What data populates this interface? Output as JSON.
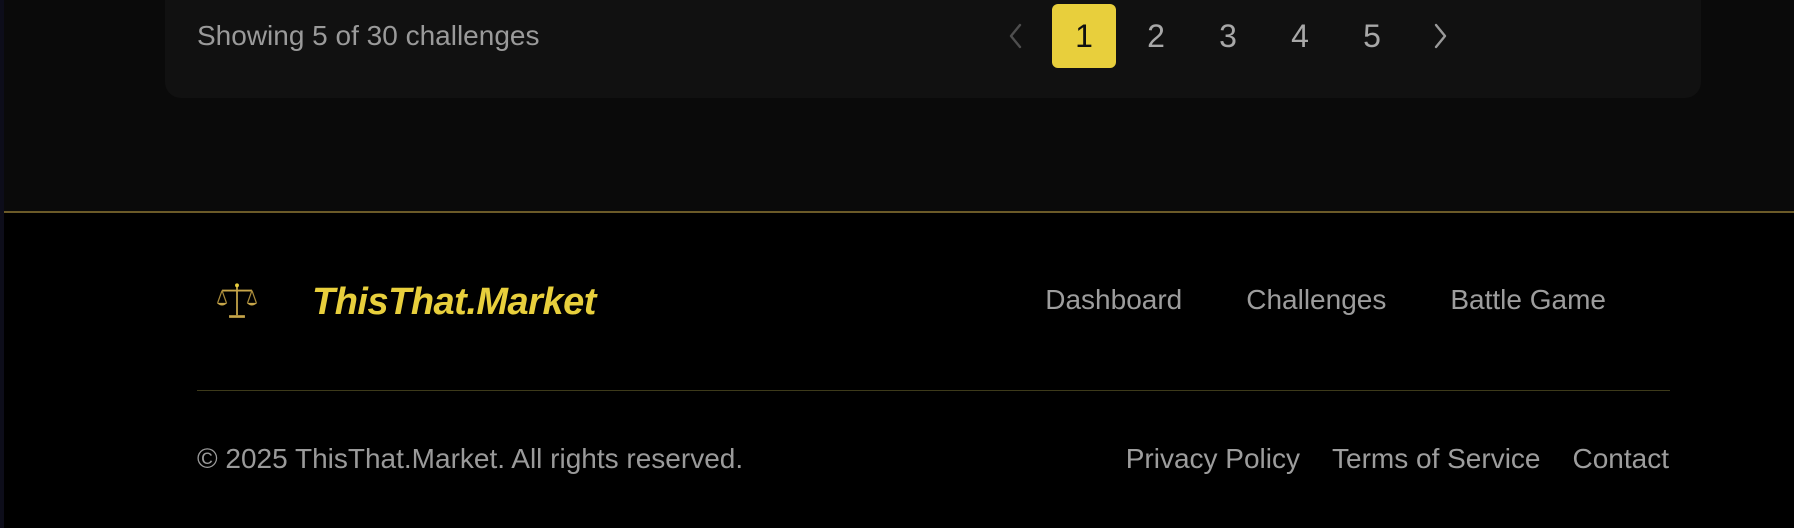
{
  "pagination": {
    "summary": "Showing 5 of 30 challenges",
    "prev_icon": "chevron-left-icon",
    "next_icon": "chevron-right-icon",
    "pages": [
      "1",
      "2",
      "3",
      "4",
      "5"
    ],
    "active_page": "1"
  },
  "footer": {
    "brand_name": "ThisThat.Market",
    "brand_icon": "scales-icon",
    "nav": [
      "Dashboard",
      "Challenges",
      "Battle Game"
    ],
    "copyright": "© 2025 ThisThat.Market. All rights reserved.",
    "legal": [
      "Privacy Policy",
      "Terms of Service",
      "Contact"
    ]
  },
  "colors": {
    "accent": "#e8cf3c",
    "background": "#0a0a0a",
    "card": "#111111",
    "footer_bg": "#000000",
    "footer_border": "#6b5a28",
    "muted_text": "#9a9a9a"
  }
}
